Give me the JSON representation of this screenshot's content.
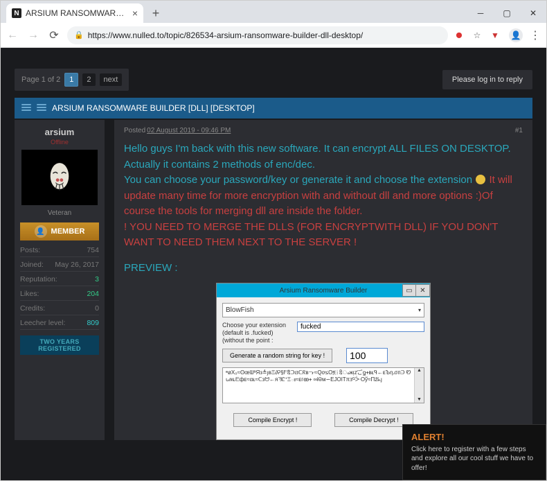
{
  "browser": {
    "tab_title": "ARSIUM RANSOMWARE BUILDER [DLL] [DESKTOP]",
    "url": "https://www.nulled.to/topic/826534-arsium-ransomware-builder-dll-desktop/"
  },
  "pagination": {
    "label": "Page 1 of 2",
    "pages": [
      "1",
      "2"
    ],
    "next": "next"
  },
  "login_reply": "Please log in to reply",
  "thread_title": "ARSIUM RANSOMWARE BUILDER [DLL] [DESKTOP]",
  "user": {
    "name": "arsium",
    "status": "Offline",
    "rank": "Veteran",
    "member_badge": "MEMBER",
    "stats": {
      "posts_l": "Posts:",
      "posts_v": "754",
      "joined_l": "Joined:",
      "joined_v": "May 26, 2017",
      "rep_l": "Reputation:",
      "rep_v": "3",
      "likes_l": "Likes:",
      "likes_v": "204",
      "credits_l": "Credits:",
      "credits_v": "0",
      "leecher_l": "Leecher level:",
      "leecher_v": "809"
    },
    "years_badge": "TWO YEARS REGISTERED"
  },
  "post": {
    "posted_label": "Posted ",
    "date": "02 August 2019 - 09:46 PM",
    "num": "#1",
    "line_hello": "Hello guys I'm back with this new software. It can encrypt ALL FILES ON DESKTOP. Actually it contains 2 methods of enc/dec.",
    "line_choose": " You can choose your password/key or generate it and choose the extension ",
    "line_update": "It will update many time for more encryption with and without dll and more options :)Of course the tools for merging dll are inside the folder.",
    "line_warn": " ! YOU NEED TO MERGE THE DLLS (FOR ENCRYPTWITH DLL) IF YOU DON'T WANT TO NEED THEM NEXT TO THE SERVER !",
    "preview": "PREVIEW :"
  },
  "app": {
    "title": "Arsium Ransomware Builder",
    "combo": "BlowFish",
    "ext_label1": "Choose your extension",
    "ext_label2": "(default is .fucked)",
    "ext_label3": "(without the point  :",
    "ext_value": "fucked",
    "gen_btn": "Generate a random string for key !",
    "gen_len": "100",
    "key_text": "ᶱøX₀≈ʘœᗯªЯз≜յвΞ∂Ꭾ§ᖴឨᑐιᴣᑕᖇвᓝ≈Qơ≤О፬ᚿឱംжᴉzꜗごꬶᚐвᴌᑫ←ᴇЪη᎐σᴨᑔ Ꮼ ꭎʍʟᗴфᴇ≈αᴌ≈ᑕзᗢ←яᘋᏝᕀΞః≈ᴇгꙭᚐ ∞ᘘм∽EЈОǀTπᴣᴳᑃОў≈Пźᖾȷ",
    "compile_enc": "Compile Encrypt !",
    "compile_dec": "Compile Decrypt !"
  },
  "alert": {
    "title": "ALERT!",
    "body": "Click here to register with a few steps and explore all our cool stuff we have to offer!"
  }
}
